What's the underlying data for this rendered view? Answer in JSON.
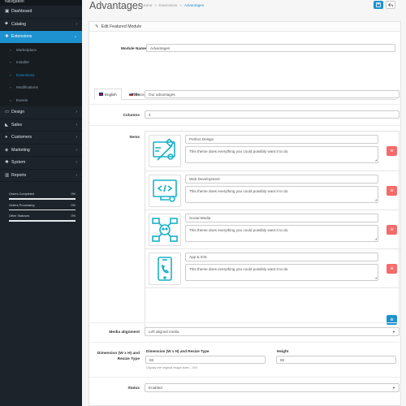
{
  "sidebar": {
    "top_text": "Navigation",
    "items": [
      {
        "label": "Dashboard",
        "icon": "dashboard-icon",
        "glyph": "▣",
        "has_children": false
      },
      {
        "label": "Catalog",
        "icon": "tag-icon",
        "glyph": "⬥",
        "has_children": true
      },
      {
        "label": "Extensions",
        "icon": "puzzle-icon",
        "glyph": "✚",
        "has_children": true
      }
    ],
    "sub_items": [
      {
        "label": "Marketplace"
      },
      {
        "label": "Installer"
      },
      {
        "label": "Extensions"
      },
      {
        "label": "Modifications"
      },
      {
        "label": "Events"
      }
    ],
    "items2": [
      {
        "label": "Design",
        "icon": "monitor-icon",
        "glyph": "▭"
      },
      {
        "label": "Sales",
        "icon": "cart-icon",
        "glyph": "◣"
      },
      {
        "label": "Customers",
        "icon": "user-icon",
        "glyph": "●"
      },
      {
        "label": "Marketing",
        "icon": "share-icon",
        "glyph": "◈"
      },
      {
        "label": "System",
        "icon": "gear-icon",
        "glyph": "✱"
      },
      {
        "label": "Reports",
        "icon": "bar-chart-icon",
        "glyph": "▥"
      }
    ],
    "stats": [
      {
        "label": "Orders Completed",
        "value": "0%"
      },
      {
        "label": "Orders Processing",
        "value": "0%"
      },
      {
        "label": "Other Statuses",
        "value": "0%"
      }
    ]
  },
  "header": {
    "title": "Advantages",
    "breadcrumb": [
      "Home",
      "»",
      "Extensions",
      "»",
      "Advantages"
    ],
    "save_icon": "save-icon",
    "back_icon": "back-icon"
  },
  "panel": {
    "heading": "Edit Featured Module",
    "module_name_label": "Module Name",
    "module_name_value": "Advantages",
    "tabs": [
      {
        "label": "English",
        "flag": "uk",
        "active": true
      },
      {
        "label": "Russian",
        "flag": "ru",
        "active": false
      }
    ],
    "title_label": "Title",
    "title_value": "Our advantages",
    "columns_label": "Columns",
    "columns_value": "4",
    "items_label": "Items",
    "items": [
      {
        "title": "Perfect Design",
        "desc": "This theme does everything you could possibly want it to do.",
        "icon": "design-tools-icon"
      },
      {
        "title": "Web Development",
        "desc": "This theme does everything you could possibly want it to do.",
        "icon": "web-development-icon"
      },
      {
        "title": "Social Media",
        "desc": "This theme does everything you could possibly want it to do.",
        "icon": "social-media-icon"
      },
      {
        "title": "App & IOS",
        "desc": "This theme does everything you could possibly want it to do.",
        "icon": "mobile-app-icon"
      }
    ],
    "media_alignment_label": "Media alignment",
    "media_alignment_value": "Left aligned media",
    "dimension_label": "Dimension (W x H) and Resize Type",
    "dimension_sub_label": "Dimension (W x H) and Resize Type",
    "dimension_value": "55",
    "dimension_help": "Display the original image sizes - 0x0",
    "height_label": "Height",
    "height_value": "55",
    "status_label": "Status",
    "status_value": "Enabled"
  },
  "colors": {
    "sidebar_bg": "#1d232a",
    "accent": "#1e91cf",
    "danger": "#f56b6b",
    "icon_teal": "#1ab0c8"
  }
}
